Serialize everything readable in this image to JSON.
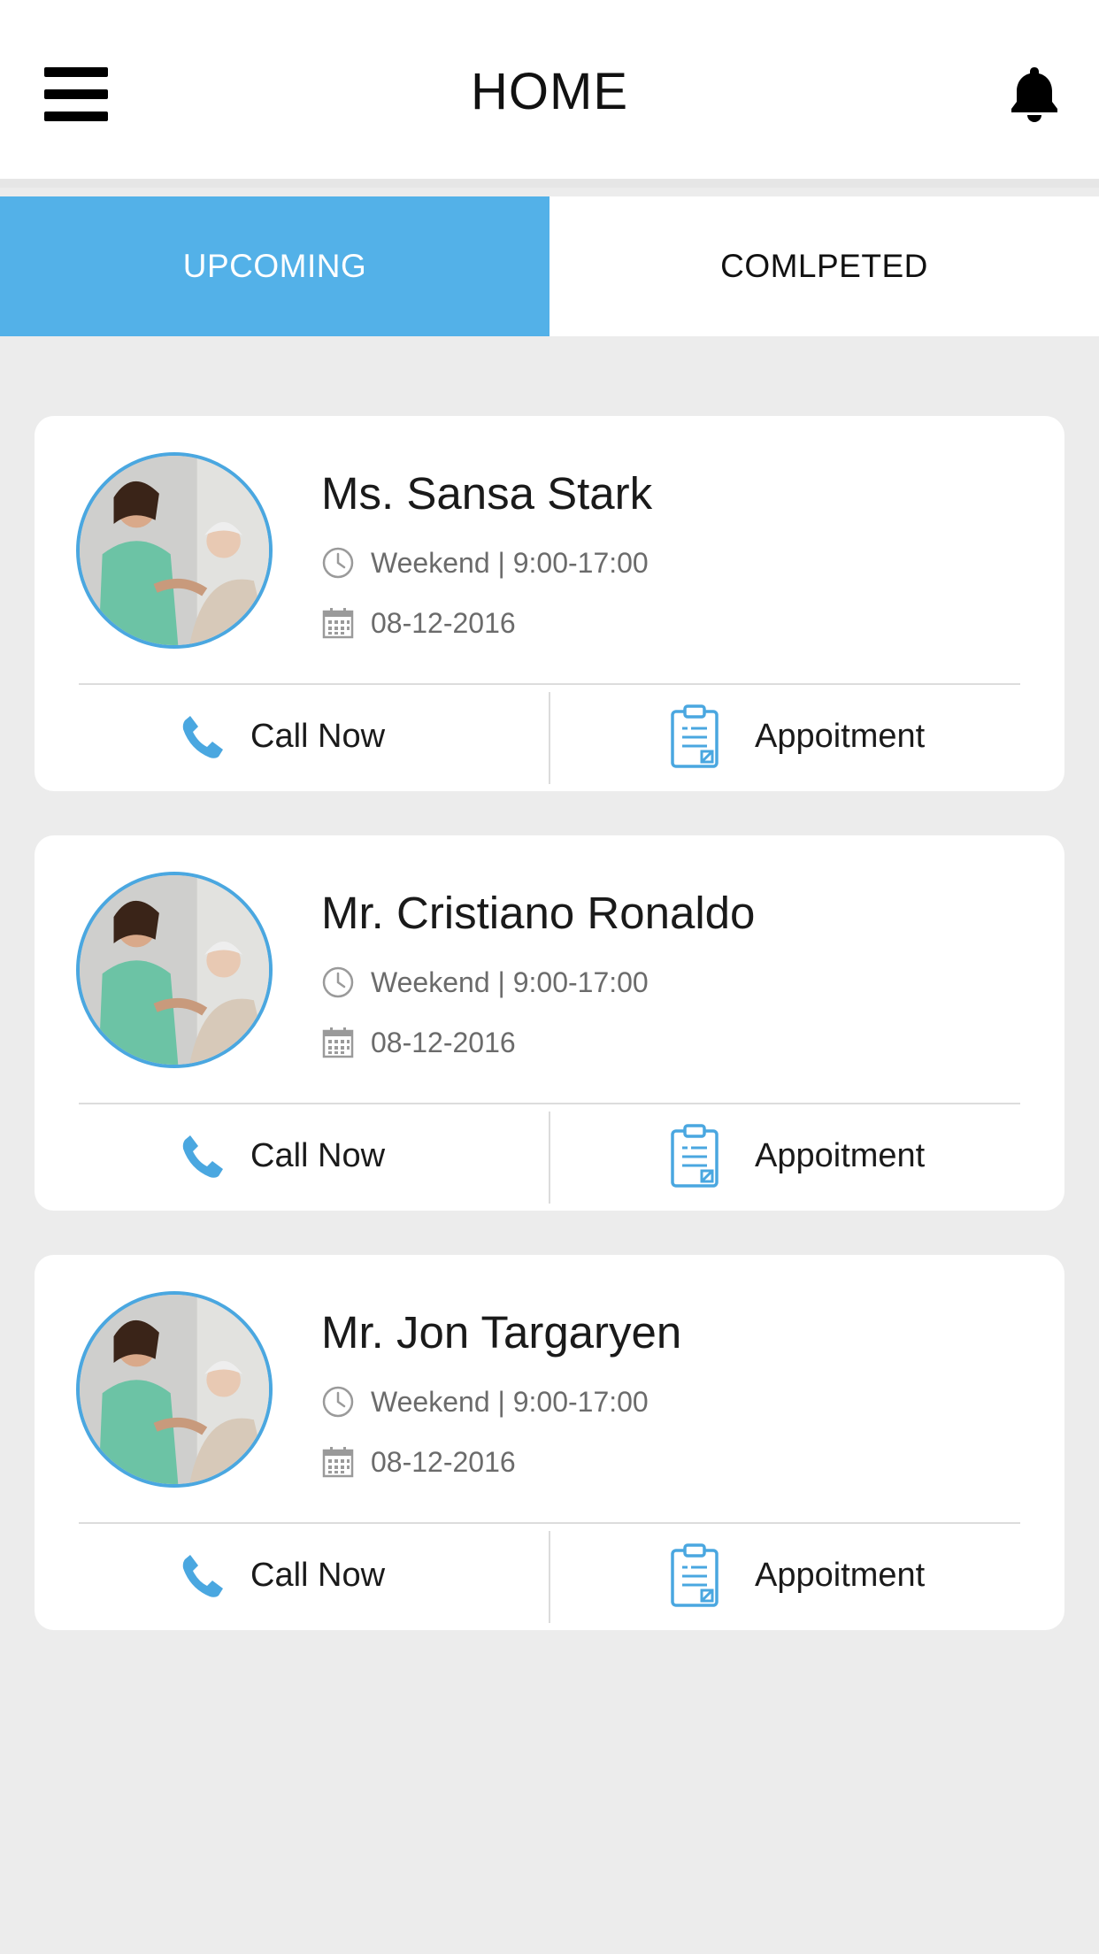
{
  "header": {
    "title": "HOME",
    "menu_icon": "hamburger-menu-icon",
    "notification_icon": "bell-icon"
  },
  "tabs": [
    {
      "label": "UPCOMING",
      "active": true
    },
    {
      "label": "COMLPETED",
      "active": false
    }
  ],
  "colors": {
    "accent": "#53b1e8",
    "background": "#ececec",
    "card": "#ffffff"
  },
  "appointments": [
    {
      "name": "Ms. Sansa Stark",
      "schedule": "Weekend | 9:00-17:00",
      "date": "08-12-2016",
      "call_label": "Call Now",
      "appointment_label": "Appoitment"
    },
    {
      "name": "Mr. Cristiano Ronaldo",
      "schedule": "Weekend | 9:00-17:00",
      "date": "08-12-2016",
      "call_label": "Call Now",
      "appointment_label": "Appoitment"
    },
    {
      "name": "Mr. Jon Targaryen",
      "schedule": "Weekend | 9:00-17:00",
      "date": "08-12-2016",
      "call_label": "Call Now",
      "appointment_label": "Appoitment"
    }
  ]
}
